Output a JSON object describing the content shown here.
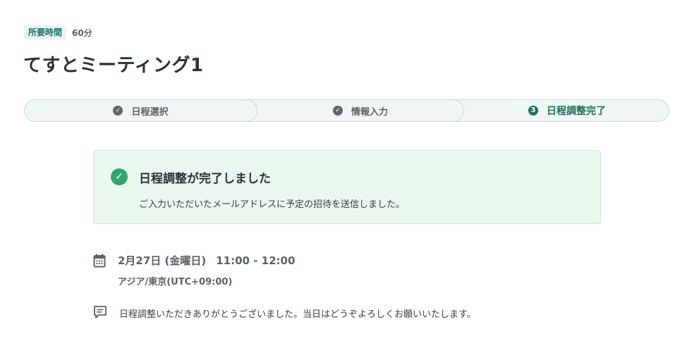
{
  "meeting": {
    "duration_label": "所要時間",
    "duration_value": "60分",
    "title": "てすとミーティング1"
  },
  "stepper": {
    "steps": [
      {
        "label": "日程選択",
        "status": "done",
        "icon": "check-circle-icon"
      },
      {
        "label": "情報入力",
        "status": "done",
        "icon": "check-circle-icon"
      },
      {
        "label": "日程調整完了",
        "status": "current",
        "number": "3"
      }
    ]
  },
  "success": {
    "title": "日程調整が完了しました",
    "message": "ご入力いただいたメールアドレスに予定の招待を送信しました。"
  },
  "event": {
    "date": "2月27日 (金曜日)",
    "time": "11:00 - 12:00",
    "timezone": "アジア/東京(UTC+09:00)",
    "message": "日程調整いただきありがとうございました。当日はどうぞよろしくお願いいたします。"
  },
  "colors": {
    "accent": "#1f6f62",
    "success": "#2fa76d",
    "success_bg": "#eaf7ee",
    "stepper_bg": "#eef7f3"
  }
}
